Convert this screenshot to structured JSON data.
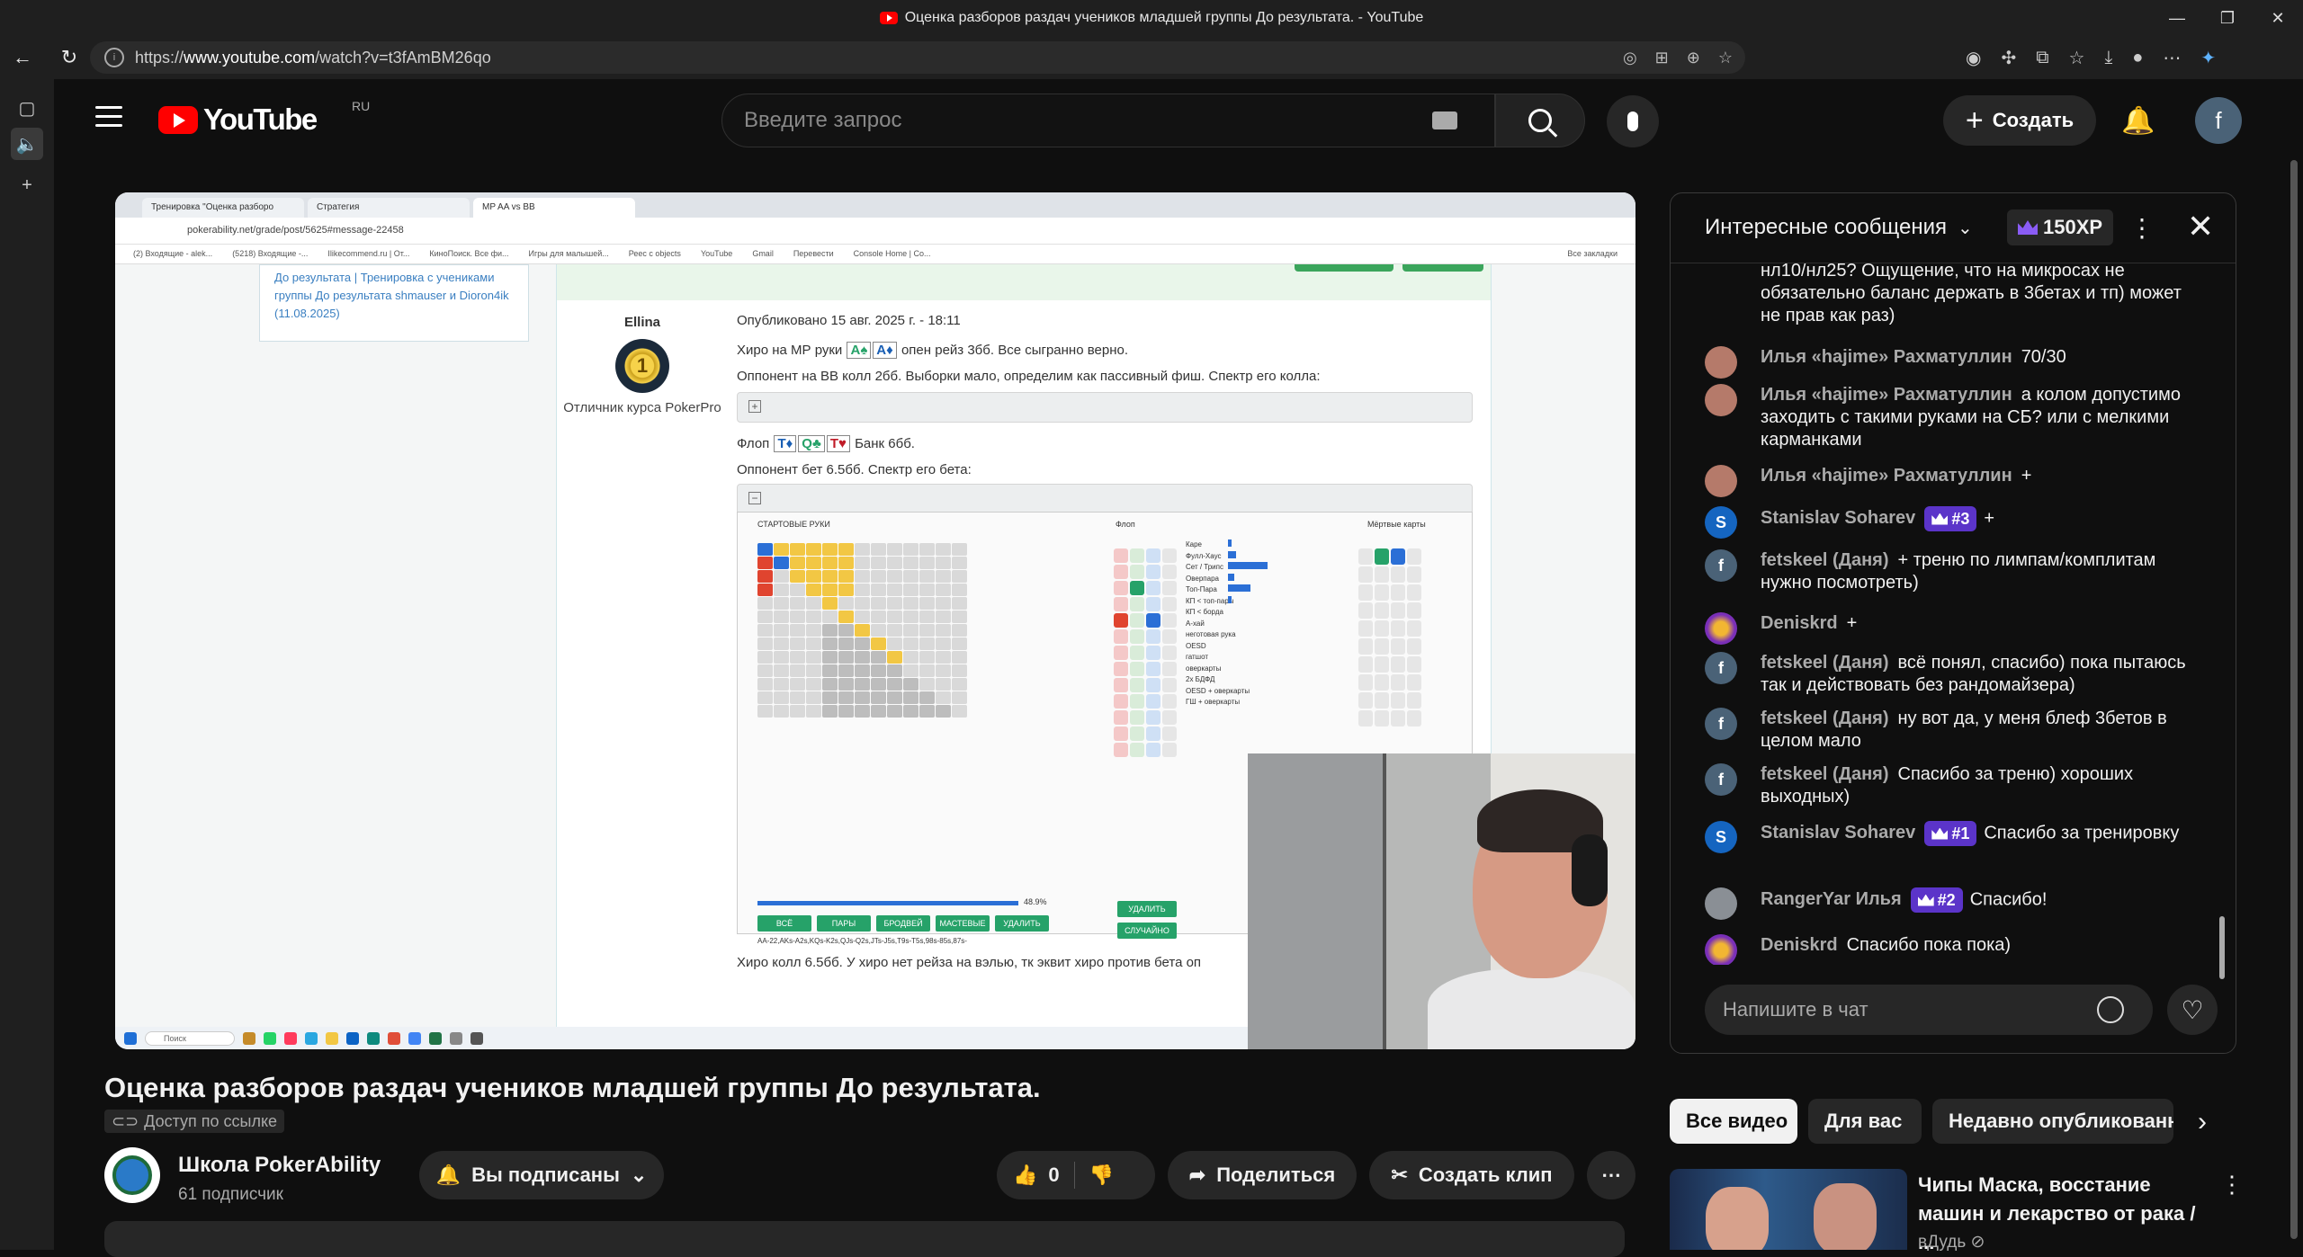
{
  "browser": {
    "window_title": "Оценка разборов раздач учеников младшей группы До результата. - YouTube",
    "url_prefix": "https://",
    "url_host": "www.youtube.com",
    "url_path": "/watch?v=t3fAmBM26qo"
  },
  "masthead": {
    "logo_text": "YouTube",
    "region": "RU",
    "search_placeholder": "Введите запрос",
    "create_label": "Создать",
    "avatar_letter": "f"
  },
  "video": {
    "title": "Оценка разборов раздач учеников младшей группы До результата.",
    "visibility": "Доступ по ссылке",
    "channel_name": "Школа PokerAbility",
    "subscribers": "61 подписчик",
    "subscribe_label": "Вы подписаны",
    "likes": "0",
    "share_label": "Поделиться",
    "clip_label": "Создать клип"
  },
  "captured": {
    "tabs": [
      "Тренировка \"Оценка разборо",
      "Стратегия",
      "MP AA vs BB"
    ],
    "url": "pokerability.net/grade/post/5625#message-22458",
    "bookmarks": [
      "(2) Входящие - alek...",
      "(5218) Входящие -...",
      "Ilikecommend.ru | От...",
      "КиноПоиск. Все фи...",
      "Игры для малышей...",
      "Реес с objects",
      "YouTube",
      "Gmail",
      "Перевести",
      "Console Home | Co..."
    ],
    "bookmarks_all": "Все закладки",
    "left_box": "До результата | Тренировка с учениками группы До результата shmauser и Dioron4ik (11.08.2025)",
    "user_name": "Ellina",
    "user_rank": "Отличник курса PokerPro",
    "published": "Опубликовано 15 авг. 2025 г. - 18:11",
    "line1_pre": "Хиро на МР руки",
    "line1_post": "опен рейз 3бб. Все сыгранно верно.",
    "line2": "Оппонент на BB колл 2бб. Выборки мало, определим как пассивный фиш. Спектр его колла:",
    "flop_label": "Флоп",
    "flop_post": "Банк 6бб.",
    "line4": "Оппонент бет 6.5бб. Спектр его бета:",
    "line5": "Хиро колл 6.5бб. У хиро нет рейза на вэлью, тк эквит хиро против бета оп",
    "card_a1": "A♠",
    "card_a2": "A♦",
    "flop_c1": "T♦",
    "flop_c2": "Q♣",
    "flop_c3": "T♥",
    "tool_header": "СТАРТОВЫЕ РУКИ",
    "tool_flop": "Флоп",
    "tool_dead": "Мёртвые карты",
    "stats": [
      "Каре",
      "Фулл-Хаус",
      "Сет / Трипс",
      "Оверпара",
      "Топ-Пара",
      "КП < топ-пары",
      "КП < борда",
      "А-хай",
      "неготовая рука",
      "",
      "OESD",
      "гатшот",
      "оверкарты",
      "2x БДФД",
      "",
      "OESD + оверкарты",
      "ГШ + оверкарты"
    ],
    "stats_pct": [
      "1.16%",
      "10.47%",
      "48.84%",
      "8.14%",
      "27.91%",
      "3.49%"
    ],
    "tool_buttons": [
      "ВСЁ",
      "ПАРЫ",
      "БРОДВЕЙ",
      "МАСТЕВЫЕ",
      "УДАЛИТЬ"
    ],
    "tool_range": "AA-22,AKs-A2s,KQs-K2s,QJs-Q2s,JTs-J5s,T9s-T5s,98s-85s,87s-",
    "tool_pct": "48.9%",
    "tool_delete": "УДАЛИТЬ",
    "tool_random": "СЛУЧАЙНО",
    "taskbar_search": "Поиск"
  },
  "chat": {
    "title": "Интересные сообщения",
    "xp": "150XP",
    "input_placeholder": "Напишите в чат",
    "messages": [
      {
        "author": "",
        "text": "нл10/нл25? Ощущение, что на микросах не обязательно баланс держать в 3бетах и тп) может не прав как раз)"
      },
      {
        "author": "Илья «hajime» Рахматуллин",
        "text": "70/30"
      },
      {
        "author": "Илья «hajime» Рахматуллин",
        "text": "а колом допустимо заходить с такими руками на СБ? или с мелкими карманками"
      },
      {
        "author": "Илья «hajime» Рахматуллин",
        "text": "+"
      },
      {
        "author": "Stanislav Soharev",
        "badge": "#3",
        "text": "+"
      },
      {
        "author": "fetskeel (Даня)",
        "text": "+ треню по лимпам/комплитам нужно посмотреть)"
      },
      {
        "author": "Deniskrd",
        "text": "+"
      },
      {
        "author": "fetskeel (Даня)",
        "text": "всё понял, спасибо) пока пытаюсь так и действовать без рандомайзера)"
      },
      {
        "author": "fetskeel (Даня)",
        "text": "ну вот да, у меня блеф 3бетов в целом мало"
      },
      {
        "author": "fetskeel (Даня)",
        "text": "Спасибо за треню) хороших выходных)"
      },
      {
        "author": "Stanislav Soharev",
        "badge": "#1",
        "text": "Спасибо за тренировку"
      },
      {
        "author": "RangerYar Илья",
        "badge": "#2",
        "text": "Спасибо!"
      },
      {
        "author": "Deniskrd",
        "text": "Спасибо пока пока)"
      }
    ]
  },
  "recommendations": {
    "chips": [
      "Все видео",
      "Для вас",
      "Недавно опубликованн"
    ],
    "video_title": "Чипы Маска, восстание машин и лекарство от рака / ...",
    "video_channel": "вДудь ⊘"
  },
  "colors": {
    "background": "#0f0f0f",
    "youtube_red": "#ff0000",
    "badge_purple": "#5b34c9"
  }
}
